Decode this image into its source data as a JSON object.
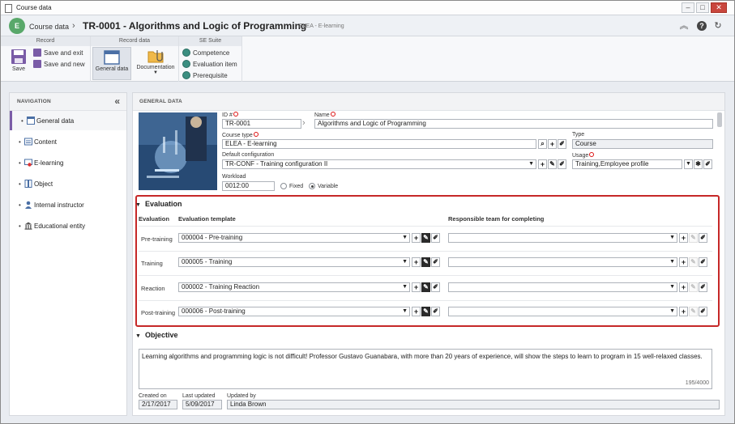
{
  "window": {
    "title": "Course data"
  },
  "header": {
    "logo_text": "E",
    "breadcrumb": "Course data",
    "title": "TR-0001 - Algorithms and Logic of Programming",
    "subtitle": "ELEA - E-learning"
  },
  "ribbon": {
    "record": {
      "title": "Record",
      "save": "Save",
      "save_exit": "Save and exit",
      "save_new": "Save and new"
    },
    "record_data": {
      "title": "Record data",
      "general_data": "General data",
      "documentation": "Documentation"
    },
    "se_suite": {
      "title": "SE Suite",
      "competence": "Competence",
      "evaluation_item": "Evaluation item",
      "prerequisite": "Prerequisite"
    }
  },
  "nav": {
    "title": "NAVIGATION",
    "items": [
      {
        "label": "General data",
        "icon": "form-icon"
      },
      {
        "label": "Content",
        "icon": "content-icon"
      },
      {
        "label": "E-learning",
        "icon": "elearning-icon"
      },
      {
        "label": "Object",
        "icon": "object-icon"
      },
      {
        "label": "Internal instructor",
        "icon": "instructor-icon"
      },
      {
        "label": "Educational entity",
        "icon": "building-icon"
      }
    ]
  },
  "general": {
    "section_title": "GENERAL DATA",
    "id_label": "ID #",
    "id_value": "TR-0001",
    "name_label": "Name",
    "name_value": "Algorithms and Logic of Programming",
    "course_type_label": "Course type",
    "course_type_value": "ELEA - E-learning",
    "type_label": "Type",
    "type_value": "Course",
    "default_config_label": "Default configuration",
    "default_config_value": "TR-CONF - Training configuration II",
    "usage_label": "Usage",
    "usage_value": "Training,Employee profile",
    "workload_label": "Workload",
    "workload_value": "0012:00",
    "fixed_label": "Fixed",
    "variable_label": "Variable",
    "workload_mode": "Variable"
  },
  "evaluation": {
    "title": "Evaluation",
    "col_evaluation": "Evaluation",
    "col_template": "Evaluation template",
    "col_team": "Responsible team for completing",
    "rows": [
      {
        "label": "Pre-training",
        "template": "000004 - Pre-training",
        "team": ""
      },
      {
        "label": "Training",
        "template": "000005 - Training",
        "team": ""
      },
      {
        "label": "Reaction",
        "template": "000002 - Training Reaction",
        "team": ""
      },
      {
        "label": "Post-training",
        "template": "000006 - Post-training",
        "team": ""
      }
    ]
  },
  "objective": {
    "title": "Objective",
    "text": "Learning algorithms and programming logic is not difficult! Professor Gustavo Guanabara, with more than 20 years of experience, will show the steps to learn to program in 15 well-relaxed classes.",
    "counter": "195/4000"
  },
  "footer": {
    "created_label": "Created on",
    "created_value": "2/17/2017",
    "updated_label": "Last updated",
    "updated_value": "5/09/2017",
    "updated_by_label": "Updated by",
    "updated_by_value": "Linda Brown"
  },
  "colors": {
    "accent": "#7a5ca7",
    "highlight": "#c62828",
    "logo": "#59a86a"
  }
}
